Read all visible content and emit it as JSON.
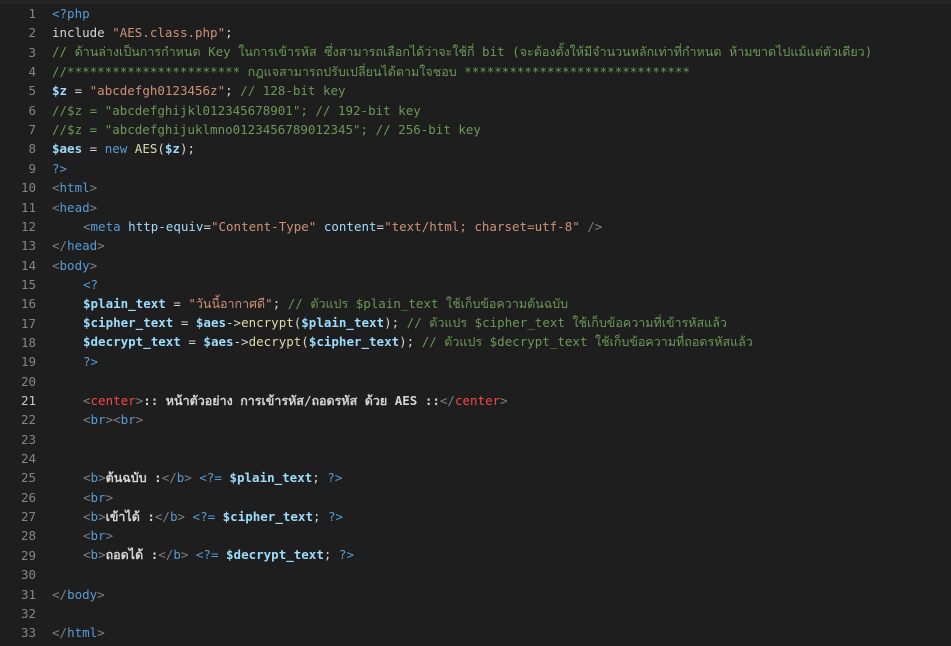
{
  "editor": {
    "current_line": 21,
    "lines": [
      {
        "n": "1",
        "segs": [
          [
            "php",
            "<?php"
          ]
        ]
      },
      {
        "n": "2",
        "segs": [
          [
            "plain",
            "include "
          ],
          [
            "str",
            "\"AES.class.php\""
          ],
          [
            "plain",
            ";"
          ]
        ]
      },
      {
        "n": "3",
        "segs": [
          [
            "cm",
            "// ด้านล่างเป็นการกำหนด Key ในการเข้ารหัส ซึ่งสามารถเลือกได้ว่าจะใช้กี่ bit (จะต้องตั้งให้มีจำนวนหลักเท่าที่กำหนด ห้ามขาดไปแม้แต่ตัวเดียว)"
          ]
        ]
      },
      {
        "n": "4",
        "segs": [
          [
            "cm",
            "//*********************** กฎแจสามารถปรับเปลี่ยนได้ตามใจชอบ ******************************"
          ]
        ]
      },
      {
        "n": "5",
        "segs": [
          [
            "var",
            "$z"
          ],
          [
            "plain",
            " = "
          ],
          [
            "str",
            "\"abcdefgh0123456z\""
          ],
          [
            "plain",
            "; "
          ],
          [
            "cm",
            "// 128-bit key"
          ]
        ]
      },
      {
        "n": "6",
        "segs": [
          [
            "cm",
            "//$z = \"abcdefghijkl012345678901\"; // 192-bit key"
          ]
        ]
      },
      {
        "n": "7",
        "segs": [
          [
            "cm",
            "//$z = \"abcdefghijuklmno0123456789012345\"; // 256-bit key"
          ]
        ]
      },
      {
        "n": "8",
        "segs": [
          [
            "var",
            "$aes"
          ],
          [
            "plain",
            " = "
          ],
          [
            "k",
            "new "
          ],
          [
            "fn",
            "AES"
          ],
          [
            "plain",
            "("
          ],
          [
            "var",
            "$z"
          ],
          [
            "plain",
            ");"
          ]
        ]
      },
      {
        "n": "9",
        "segs": [
          [
            "php",
            "?>"
          ]
        ]
      },
      {
        "n": "10",
        "segs": [
          [
            "kw-tag",
            "<"
          ],
          [
            "tag",
            "html"
          ],
          [
            "kw-tag",
            ">"
          ]
        ]
      },
      {
        "n": "11",
        "segs": [
          [
            "kw-tag",
            "<"
          ],
          [
            "tag",
            "head"
          ],
          [
            "kw-tag",
            ">"
          ]
        ]
      },
      {
        "n": "12",
        "indent": 1,
        "segs": [
          [
            "kw-tag",
            "<"
          ],
          [
            "tag",
            "meta "
          ],
          [
            "attr",
            "http-equiv"
          ],
          [
            "plain",
            "="
          ],
          [
            "str",
            "\"Content-Type\""
          ],
          [
            "plain",
            " "
          ],
          [
            "attr",
            "content"
          ],
          [
            "plain",
            "="
          ],
          [
            "str",
            "\"text/html; charset=utf-8\""
          ],
          [
            "plain",
            " "
          ],
          [
            "kw-tag",
            "/>"
          ]
        ]
      },
      {
        "n": "13",
        "segs": [
          [
            "kw-tag",
            "</"
          ],
          [
            "tag",
            "head"
          ],
          [
            "kw-tag",
            ">"
          ]
        ]
      },
      {
        "n": "14",
        "segs": [
          [
            "kw-tag",
            "<"
          ],
          [
            "tag",
            "body"
          ],
          [
            "kw-tag",
            ">"
          ]
        ]
      },
      {
        "n": "15",
        "indent": 1,
        "segs": [
          [
            "php",
            "<?"
          ]
        ]
      },
      {
        "n": "16",
        "indent": 1,
        "segs": [
          [
            "var",
            "$plain_text"
          ],
          [
            "plain",
            " = "
          ],
          [
            "str",
            "\"วันนี้อากาศดี\""
          ],
          [
            "plain",
            "; "
          ],
          [
            "cm",
            "// ตัวแปร $plain_text ใช้เก็บข้อความต้นฉบับ"
          ]
        ]
      },
      {
        "n": "17",
        "indent": 1,
        "segs": [
          [
            "var",
            "$cipher_text"
          ],
          [
            "plain",
            " = "
          ],
          [
            "var",
            "$aes"
          ],
          [
            "plain",
            "->"
          ],
          [
            "fn",
            "encrypt"
          ],
          [
            "plain",
            "("
          ],
          [
            "var",
            "$plain_text"
          ],
          [
            "plain",
            "); "
          ],
          [
            "cm",
            "// ตัวแปร $cipher_text ใช้เก็บข้อความที่เข้ารหัสแล้ว"
          ]
        ]
      },
      {
        "n": "18",
        "indent": 1,
        "segs": [
          [
            "var",
            "$decrypt_text"
          ],
          [
            "plain",
            " = "
          ],
          [
            "var",
            "$aes"
          ],
          [
            "plain",
            "->"
          ],
          [
            "fn",
            "decrypt"
          ],
          [
            "plain",
            "("
          ],
          [
            "var",
            "$cipher_text"
          ],
          [
            "plain",
            "); "
          ],
          [
            "cm",
            "// ตัวแปร $decrypt_text ใช้เก็บข้อความที่ถอดรหัสแล้ว"
          ]
        ]
      },
      {
        "n": "19",
        "indent": 1,
        "segs": [
          [
            "php",
            "?>"
          ]
        ]
      },
      {
        "n": "20",
        "segs": []
      },
      {
        "n": "21",
        "indent": 1,
        "segs": [
          [
            "kw-tag",
            "<"
          ],
          [
            "redtag",
            "center"
          ],
          [
            "kw-tag",
            ">"
          ],
          [
            "bold",
            ":: หน้าตัวอย่าง การเข้ารหัส/ถอดรหัส ด้วย AES ::"
          ],
          [
            "kw-tag",
            "</"
          ],
          [
            "redtag",
            "center"
          ],
          [
            "kw-tag",
            ">"
          ]
        ]
      },
      {
        "n": "22",
        "indent": 1,
        "segs": [
          [
            "kw-tag",
            "<"
          ],
          [
            "tag",
            "br"
          ],
          [
            "kw-tag",
            "><"
          ],
          [
            "tag",
            "br"
          ],
          [
            "kw-tag",
            ">"
          ]
        ]
      },
      {
        "n": "23",
        "segs": []
      },
      {
        "n": "24",
        "segs": []
      },
      {
        "n": "25",
        "indent": 1,
        "segs": [
          [
            "kw-tag",
            "<"
          ],
          [
            "tag",
            "b"
          ],
          [
            "kw-tag",
            ">"
          ],
          [
            "bold",
            "ต้นฉบับ :"
          ],
          [
            "kw-tag",
            "</"
          ],
          [
            "tag",
            "b"
          ],
          [
            "kw-tag",
            "> "
          ],
          [
            "php",
            "<?= "
          ],
          [
            "var",
            "$plain_text"
          ],
          [
            "plain",
            "; "
          ],
          [
            "php",
            "?>"
          ]
        ]
      },
      {
        "n": "26",
        "indent": 1,
        "segs": [
          [
            "kw-tag",
            "<"
          ],
          [
            "tag",
            "br"
          ],
          [
            "kw-tag",
            ">"
          ]
        ]
      },
      {
        "n": "27",
        "indent": 1,
        "segs": [
          [
            "kw-tag",
            "<"
          ],
          [
            "tag",
            "b"
          ],
          [
            "kw-tag",
            ">"
          ],
          [
            "bold",
            "เข้าได้ :"
          ],
          [
            "kw-tag",
            "</"
          ],
          [
            "tag",
            "b"
          ],
          [
            "kw-tag",
            "> "
          ],
          [
            "php",
            "<?= "
          ],
          [
            "var",
            "$cipher_text"
          ],
          [
            "plain",
            "; "
          ],
          [
            "php",
            "?>"
          ]
        ]
      },
      {
        "n": "28",
        "indent": 1,
        "segs": [
          [
            "kw-tag",
            "<"
          ],
          [
            "tag",
            "br"
          ],
          [
            "kw-tag",
            ">"
          ]
        ]
      },
      {
        "n": "29",
        "indent": 1,
        "segs": [
          [
            "kw-tag",
            "<"
          ],
          [
            "tag",
            "b"
          ],
          [
            "kw-tag",
            ">"
          ],
          [
            "bold",
            "ถอดได้ :"
          ],
          [
            "kw-tag",
            "</"
          ],
          [
            "tag",
            "b"
          ],
          [
            "kw-tag",
            "> "
          ],
          [
            "php",
            "<?= "
          ],
          [
            "var",
            "$decrypt_text"
          ],
          [
            "plain",
            "; "
          ],
          [
            "php",
            "?>"
          ]
        ]
      },
      {
        "n": "30",
        "segs": []
      },
      {
        "n": "31",
        "segs": [
          [
            "kw-tag",
            "</"
          ],
          [
            "tag",
            "body"
          ],
          [
            "kw-tag",
            ">"
          ]
        ]
      },
      {
        "n": "32",
        "segs": []
      },
      {
        "n": "33",
        "segs": [
          [
            "kw-tag",
            "</"
          ],
          [
            "tag",
            "html"
          ],
          [
            "kw-tag",
            ">"
          ]
        ]
      }
    ]
  }
}
